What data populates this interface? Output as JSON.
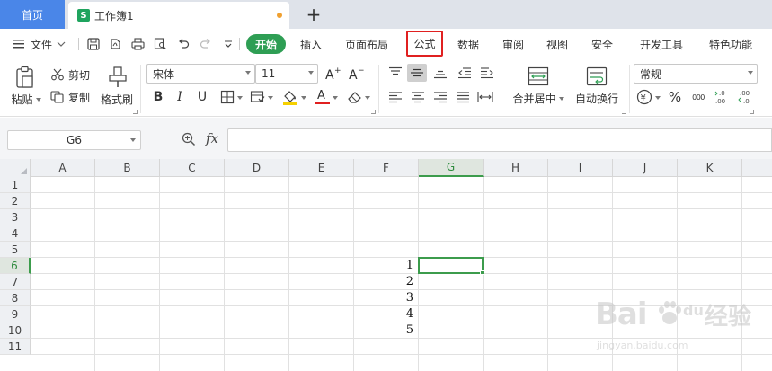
{
  "titlebar": {
    "home_tab": "首页",
    "doc_icon_letter": "S",
    "doc_title": "工作簿1",
    "new_tab_symbol": "+"
  },
  "menubar": {
    "file_label": "文件",
    "items": [
      "开始",
      "插入",
      "页面布局",
      "公式",
      "数据",
      "审阅",
      "视图",
      "安全",
      "开发工具",
      "特色功能"
    ],
    "active_item": "开始",
    "highlighted_item": "公式"
  },
  "ribbon": {
    "paste_label": "粘贴",
    "cut_label": "剪切",
    "copy_label": "复制",
    "format_painter_label": "格式刷",
    "font_name": "宋体",
    "font_size": "11",
    "bold": "B",
    "italic": "I",
    "underline": "U",
    "font_color_letter": "A",
    "merge_label": "合并居中",
    "wrap_label": "自动换行",
    "number_format": "常规",
    "percent_symbol": "%",
    "comma_symbol": "000",
    "inc_decimal": "+.0\n.00",
    "dec_decimal": ".00\n→.0",
    "font_color": "#e02020",
    "fill_color": "#f5d000"
  },
  "formulabar": {
    "name_box": "G6",
    "fx_label": "fx",
    "formula": ""
  },
  "grid": {
    "columns": [
      "A",
      "B",
      "C",
      "D",
      "E",
      "F",
      "G",
      "H",
      "I",
      "J",
      "K"
    ],
    "rows": [
      "1",
      "2",
      "3",
      "4",
      "5",
      "6",
      "7",
      "8",
      "9",
      "10",
      "11"
    ],
    "active_column": "G",
    "active_row": "6",
    "values": {
      "F6": "1",
      "F7": "2",
      "F8": "3",
      "F9": "4",
      "F10": "5"
    }
  },
  "watermark": {
    "brand": "Bai",
    "paw": "du",
    "subtitle_cn": "经验",
    "url": "jingyan.baidu.com"
  },
  "colors": {
    "accent_green": "#2e9e54",
    "home_tab_blue": "#4a86e8",
    "highlight_red": "#e02020",
    "selection_green": "#3c9c4c"
  }
}
